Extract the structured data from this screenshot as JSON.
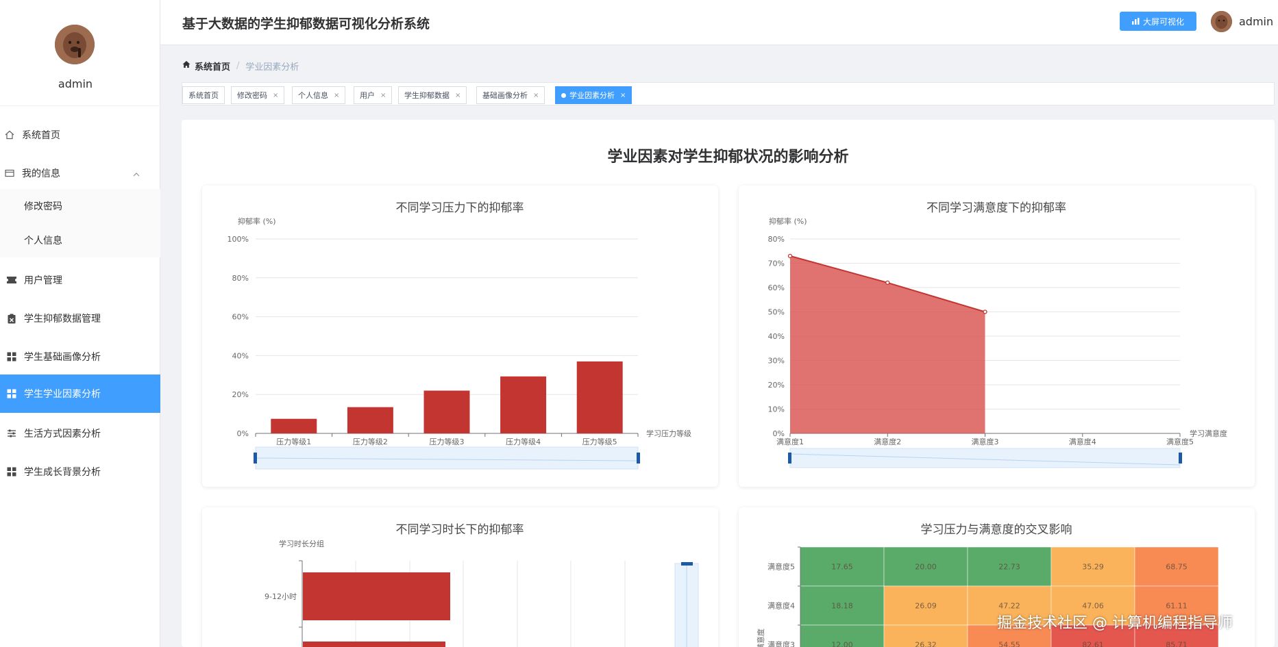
{
  "app": {
    "title": "基于大数据的学生抑郁数据可视化分析系统"
  },
  "header": {
    "bigscreen_label": "大屏可视化",
    "username": "admin"
  },
  "sidebar": {
    "username": "admin",
    "items": [
      {
        "label": "系统首页",
        "icon": "home-icon"
      },
      {
        "label": "我的信息",
        "icon": "id-card-icon"
      },
      {
        "label": "修改密码"
      },
      {
        "label": "个人信息"
      },
      {
        "label": "用户管理",
        "icon": "ticket-icon"
      },
      {
        "label": "学生抑郁数据管理",
        "icon": "clipboard-icon"
      },
      {
        "label": "学生基础画像分析",
        "icon": "grid-icon"
      },
      {
        "label": "学生学业因素分析",
        "icon": "grid-icon"
      },
      {
        "label": "生活方式因素分析",
        "icon": "sliders-icon"
      },
      {
        "label": "学生成长背景分析",
        "icon": "grid-icon"
      }
    ]
  },
  "breadcrumb": {
    "home": "系统首页",
    "separator": "/",
    "current": "学业因素分析"
  },
  "tags": [
    {
      "label": "系统首页",
      "closable": false
    },
    {
      "label": "修改密码",
      "closable": true
    },
    {
      "label": "个人信息",
      "closable": true
    },
    {
      "label": "用户",
      "closable": true
    },
    {
      "label": "学生抑郁数据",
      "closable": true
    },
    {
      "label": "基础画像分析",
      "closable": true
    },
    {
      "label": "学业因素分析",
      "closable": true,
      "active": true
    }
  ],
  "page": {
    "heading": "学业因素对学生抑郁状况的影响分析"
  },
  "colors": {
    "accent": "#409eff",
    "bar": "#c23531",
    "area": "#d9534f",
    "heat_green": "#5aaa6a",
    "heat_yellow": "#fbb35b",
    "heat_orange": "#f88a54",
    "heat_red": "#e4574f"
  },
  "watermark": "掘金技术社区 @ 计算机编程指导师",
  "chart_data": [
    {
      "type": "bar",
      "title": "不同学习压力下的抑郁率",
      "xlabel": "学习压力等级",
      "ylabel": "抑郁率 (%)",
      "categories": [
        "压力等级1",
        "压力等级2",
        "压力等级3",
        "压力等级4",
        "压力等级5"
      ],
      "values": [
        7.5,
        13.5,
        22,
        29.3,
        37
      ],
      "ylim": [
        0,
        100
      ],
      "yticks": [
        "0%",
        "20%",
        "40%",
        "60%",
        "80%",
        "100%"
      ],
      "dataZoom": "bottom slider"
    },
    {
      "type": "area",
      "title": "不同学习满意度下的抑郁率",
      "xlabel": "学习满意度",
      "ylabel": "抑郁率 (%)",
      "categories": [
        "满意度1",
        "满意度2",
        "满意度3",
        "满意度4",
        "满意度5"
      ],
      "values": [
        73,
        62,
        50,
        null,
        null
      ],
      "ylim": [
        0,
        80
      ],
      "yticks": [
        "0%",
        "10%",
        "20%",
        "30%",
        "40%",
        "50%",
        "60%",
        "70%",
        "80%"
      ],
      "dataZoom": "bottom slider"
    },
    {
      "type": "bar",
      "orientation": "horizontal",
      "title": "不同学习时长下的抑郁率",
      "ylabel": "学习时长分组",
      "categories": [
        "9-12小时"
      ],
      "dataZoom": "right slider"
    },
    {
      "type": "heatmap",
      "title": "学习压力与满意度的交叉影响",
      "ylabel": "满意度",
      "rows": [
        "满意度5",
        "满意度4",
        "满意度3"
      ],
      "values": [
        [
          17.65,
          20.0,
          22.73,
          35.29,
          68.75
        ],
        [
          18.18,
          26.09,
          47.22,
          47.06,
          61.11
        ],
        [
          12.0,
          26.32,
          54.55,
          82.61,
          85.71
        ]
      ],
      "value_labels": [
        [
          "17.65",
          "20.00",
          "22.73",
          "35.29",
          "68.75"
        ],
        [
          "18.18",
          "26.09",
          "47.22",
          "47.06",
          "61.11"
        ],
        [
          "12.00",
          "26.32",
          "54.55",
          "82.61",
          "85.71"
        ]
      ]
    }
  ]
}
